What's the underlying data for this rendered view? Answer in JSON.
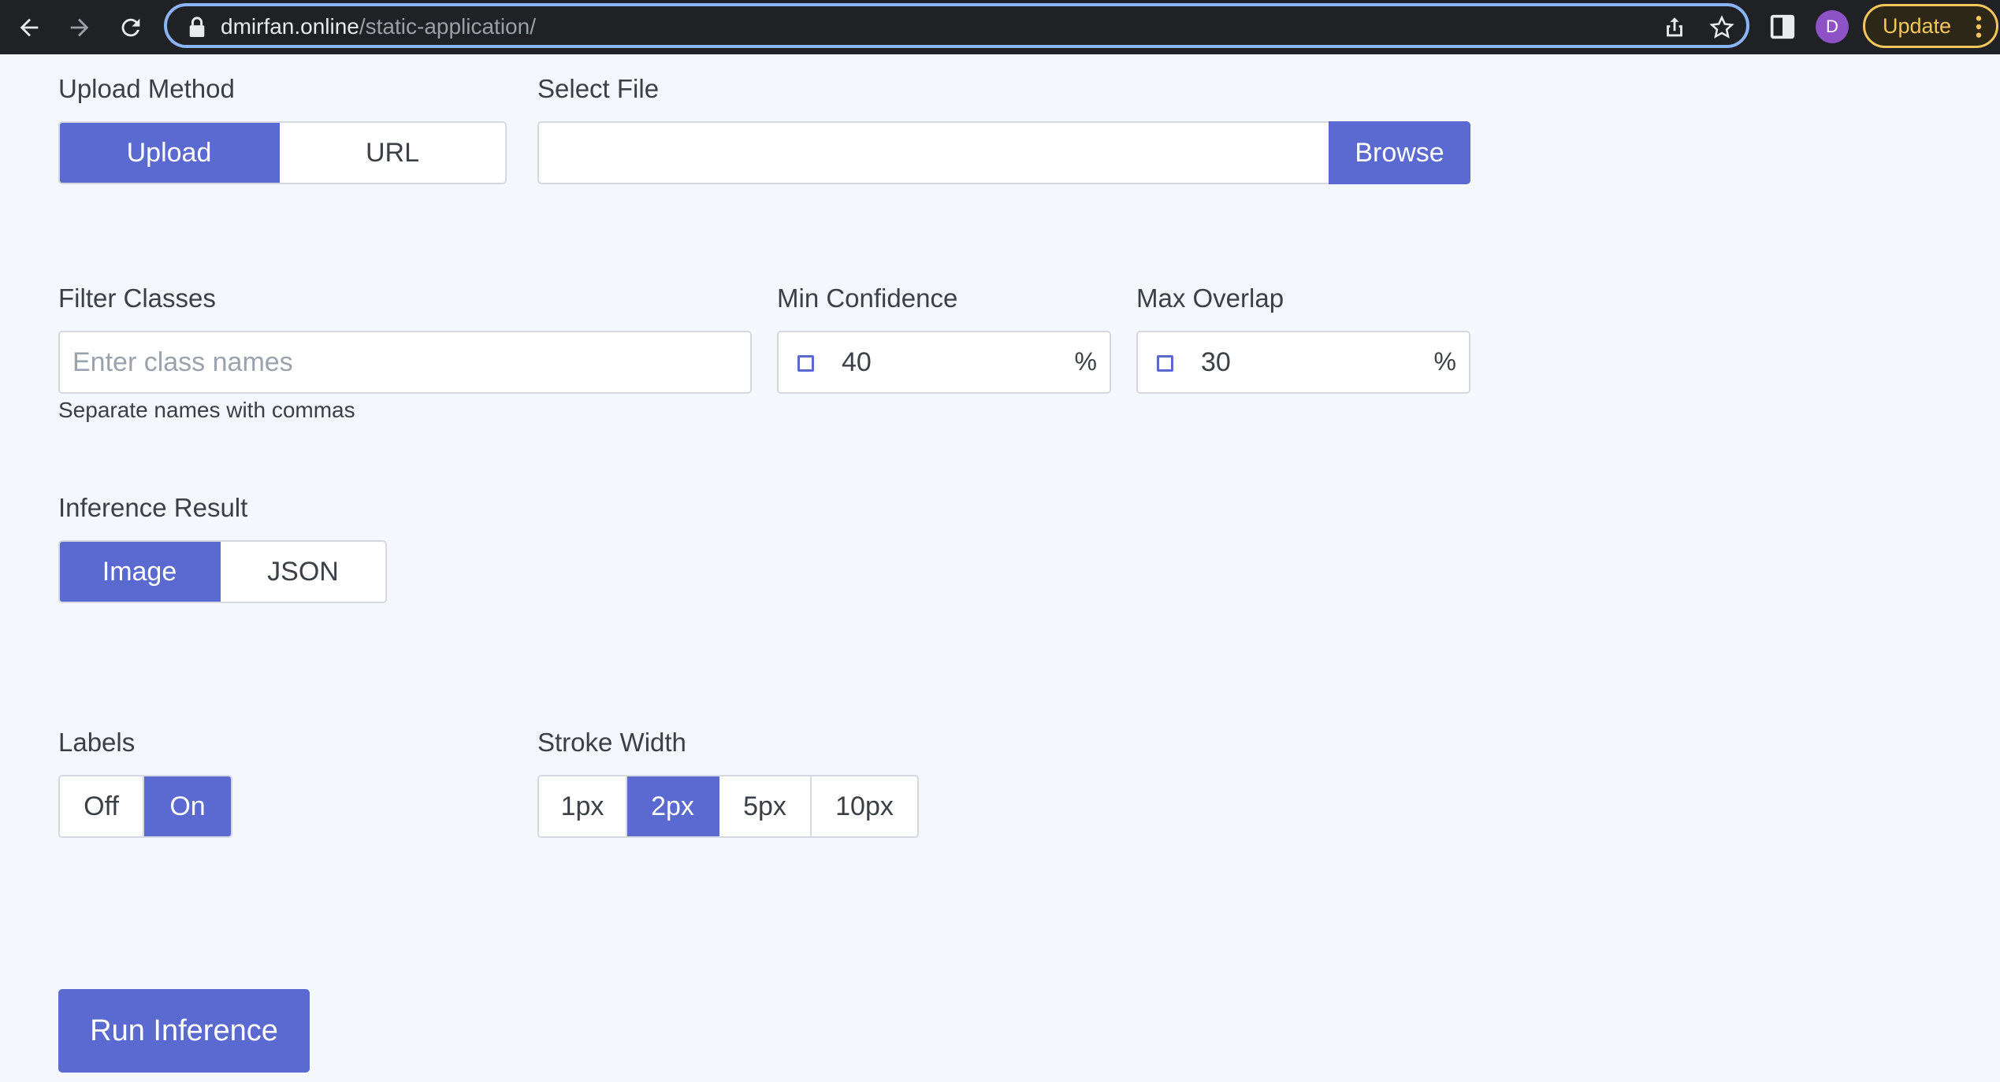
{
  "browser": {
    "url_host": "dmirfan.online",
    "url_path": "/static-application/",
    "avatar_letter": "D",
    "update_label": "Update",
    "accent_color": "#8ab4f8",
    "update_color": "#f5c659"
  },
  "upload_method": {
    "label": "Upload Method",
    "options": [
      "Upload",
      "URL"
    ],
    "selected": "Upload"
  },
  "select_file": {
    "label": "Select File",
    "value": "",
    "browse_label": "Browse"
  },
  "filter_classes": {
    "label": "Filter Classes",
    "placeholder": "Enter class names",
    "help": "Separate names with commas"
  },
  "min_confidence": {
    "label": "Min Confidence",
    "value": "40",
    "unit": "%"
  },
  "max_overlap": {
    "label": "Max Overlap",
    "value": "30",
    "unit": "%"
  },
  "inference_result": {
    "label": "Inference Result",
    "options": [
      "Image",
      "JSON"
    ],
    "selected": "Image"
  },
  "labels": {
    "label": "Labels",
    "options": [
      "Off",
      "On"
    ],
    "selected": "On"
  },
  "stroke_width": {
    "label": "Stroke Width",
    "options": [
      "1px",
      "2px",
      "5px",
      "10px"
    ],
    "selected": "2px"
  },
  "run_button": {
    "label": "Run Inference"
  },
  "colors": {
    "primary": "#5a6ad0",
    "background": "#f4f7fb",
    "border": "#d6d9df"
  }
}
